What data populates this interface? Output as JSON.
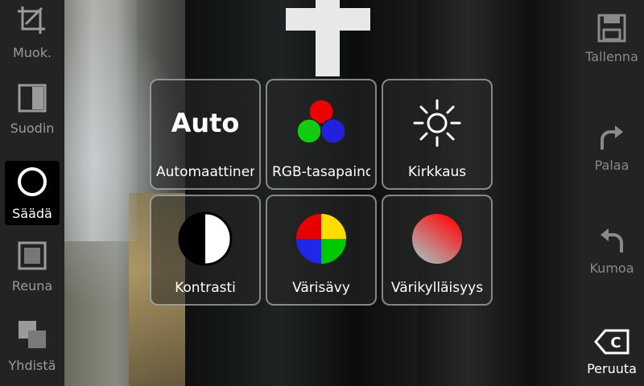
{
  "left_toolbar": {
    "items": [
      {
        "label": "Muok.",
        "icon": "crop-icon",
        "active": false
      },
      {
        "label": "Suodin",
        "icon": "filter-icon",
        "active": false
      },
      {
        "label": "Säädä",
        "icon": "adjust-circle-icon",
        "active": true
      },
      {
        "label": "Reuna",
        "icon": "frame-icon",
        "active": false
      },
      {
        "label": "Yhdistä",
        "icon": "merge-icon",
        "active": false
      }
    ]
  },
  "right_toolbar": {
    "save_label": "Tallenna",
    "redo_label": "Palaa",
    "undo_label": "Kumoa",
    "cancel_label": "Peruuta"
  },
  "adjust_tools": [
    {
      "label": "Automaattinen",
      "icon_text": "Auto"
    },
    {
      "label": "RGB-tasapaino",
      "icon": "rgb-icon"
    },
    {
      "label": "Kirkkaus",
      "icon": "brightness-icon"
    },
    {
      "label": "Kontrasti",
      "icon": "contrast-icon"
    },
    {
      "label": "Värisävy",
      "icon": "hue-icon"
    },
    {
      "label": "Värikylläisyys",
      "icon": "saturation-icon"
    }
  ],
  "colors": {
    "bar_bg": "#282828",
    "active_bg": "#000000",
    "tile_border": "#dcdcdc"
  }
}
